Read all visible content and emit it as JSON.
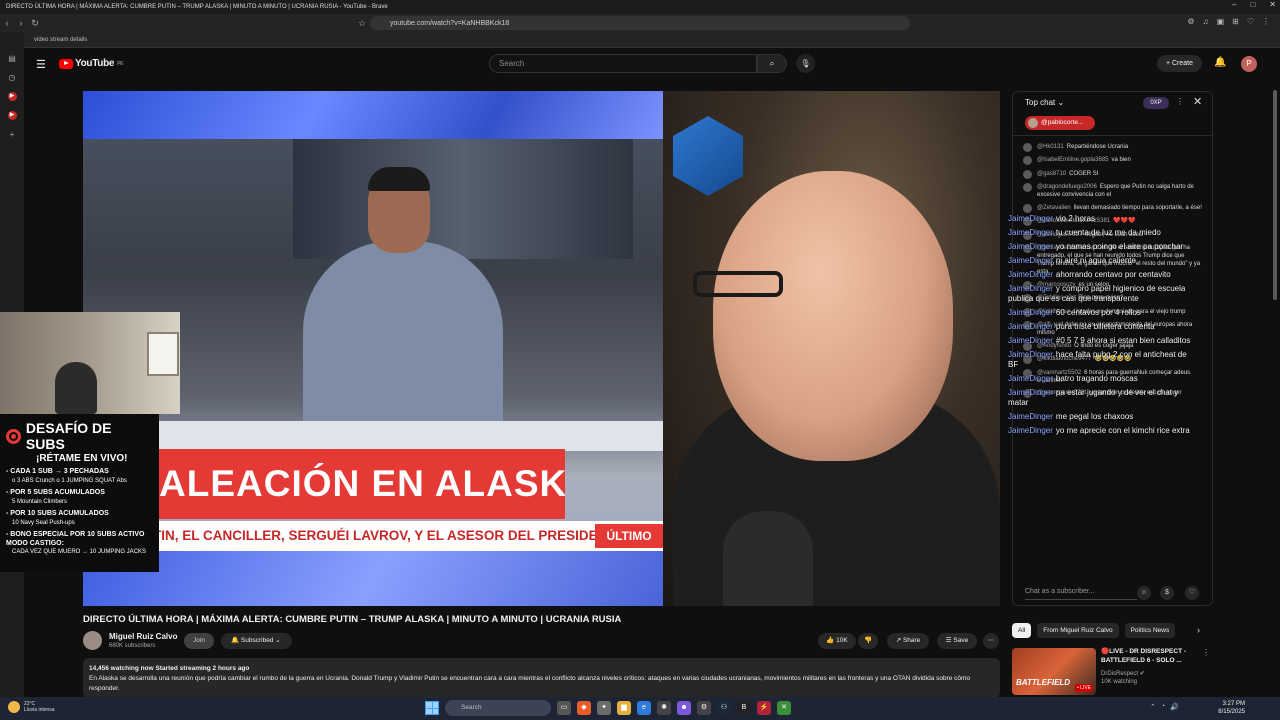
{
  "window": {
    "title": "DIRECTO ÚLTIMA HORA | MÁXIMA ALERTA: CUMBRE PUTIN – TRUMP ALASKA | MINUTO A MINUTO | UCRANIA RUSIA - YouTube - Brave",
    "controls": [
      "–",
      "□",
      "✕"
    ]
  },
  "browser": {
    "url": "youtube.com/watch?v=KaNHBBKck18",
    "bookmark": "video stream details",
    "ext_icons": [
      "⚙",
      "♫",
      "▣",
      "⊞",
      "♡",
      "⋮"
    ]
  },
  "youtube": {
    "logo_text": "YouTube",
    "logo_sup": "PE",
    "search_placeholder": "Search",
    "create_label": "+ Create",
    "avatar_letter": "P"
  },
  "video": {
    "lower_third": "ALEACIÓN EN ALASKA",
    "ticker": "TIN, EL CANCILLER, SERGUÉI LAVROV, Y EL ASESOR DEL PRESIDEN",
    "ticker_tag": "ÚLTIMO",
    "challenge": {
      "title": "DESAFÍO DE SUBS",
      "subtitle": "¡RÉTAME EN VIVO!",
      "items": [
        {
          "main": "- CADA 1 SUB → 3 PECHADAS",
          "small": "o 3 ABS Crunch o 1 JUMPING SQUAT Abs"
        },
        {
          "main": "- POR 5 SUBS ACUMULADOS",
          "small": "5 Mountain Climbers"
        },
        {
          "main": "- POR 10 SUBS ACUMULADOS",
          "small": "10 Navy Seal Push-ups"
        },
        {
          "main": "- BONO ESPECIAL POR 10 SUBS ACTIVO MODO CASTIGO:",
          "small": "CADA VEZ QUE MUERO → 10 JUMPING JACKS"
        }
      ]
    }
  },
  "meta": {
    "title": "DIRECTO ÚLTIMA HORA | MÁXIMA ALERTA: CUMBRE PUTIN – TRUMP ALASKA | MINUTO A MINUTO | UCRANIA RUSIA",
    "channel": "Miguel Ruiz Calvo",
    "subscribers": "680K subscribers",
    "join": "Join",
    "subscribed": "Subscribed",
    "likes": "10K",
    "share": "Share",
    "save": "Save",
    "stats": "14,456 watching now  Started streaming 2 hours ago",
    "description": "En Alaska se desarrolla una reunión que podría cambiar el rumbo de la guerra en Ucrania. Donald Trump y Vladimir Putin se encuentran cara a cara mientras el conflicto alcanza niveles críticos: ataques en varias ciudades ucranianas, movimientos militares en las fronteras y una OTAN dividida sobre cómo responder."
  },
  "chat": {
    "title": "Top chat",
    "xp": "0XP",
    "pinned_user": "@pablocorte...",
    "input_placeholder": "Chat as a subscriber...",
    "messages": [
      {
        "author": "@Hk0131",
        "text": "Repartiéndose Ucrania"
      },
      {
        "author": "@IsabelEmiline.gopla3685",
        "text": "va bien"
      },
      {
        "author": "@gas8710",
        "text": "COGER SI"
      },
      {
        "author": "@dragondefuego2006",
        "text": "Espero que Putin no salga harto de excesive convivencia con el"
      },
      {
        "author": "@Zetavalien",
        "text": "llevan demasiado tiempo para soportarle, a ése!"
      },
      {
        "author": "@carlosalbertoalvarez5381",
        "text": "❤️❤️❤️"
      },
      {
        "author": "@davidgian7337",
        "text": "Miguel, no sean asec!"
      },
      {
        "author": "@fernandezdahernanz",
        "text": "en de el territorio europeo que ha entregado, el que se han reunido todos Trump dice que Trump tendrá, se ganan que mucho \"el resto del mundo\" y ya esta."
      },
      {
        "author": "@marcoosuzy",
        "text": "es un seloo"
      },
      {
        "author": "@Tobillas-q2e",
        "text": "Bien para quien?"
      },
      {
        "author": "@lighthouse",
        "text": "Ustedes es demasiado para el viejo trump"
      },
      {
        "author": "@alfi",
        "text": "y el dolar no es el sepotomoneda del europas ahora mismo"
      },
      {
        "author": "@Andyfshito",
        "text": "O lindo es coger jajaja"
      },
      {
        "author": "@elkdiaknoche9477",
        "text": "🤣🤣🤣🤣🤣"
      },
      {
        "author": "@vanmartz5502",
        "text": "6 horas para guerraNuk começar adeus e...ahhhh"
      },
      {
        "author": "@arturogarza3731",
        "text": "yo también preferiría eso de coger"
      }
    ],
    "overlay": [
      {
        "name": "JaimeDinger",
        "text": "vio 2 horas"
      },
      {
        "name": "JaimeDinger",
        "text": "tu cuenta de luz me da miedo"
      },
      {
        "name": "JaimeDinger",
        "text": "yo namas poingo el aire pa ponchar"
      },
      {
        "name": "JaimeDinger",
        "text": "ni aire ni agua caliente"
      },
      {
        "name": "JaimeDinger",
        "text": "ahorrando centavo por centavito"
      },
      {
        "name": "JaimeDinger",
        "text": "y compro papel higienico de escuela publica que es casi que transparente"
      },
      {
        "name": "JaimeDinger",
        "text": "60 centavos por 4 rollos"
      },
      {
        "name": "JaimeDinger",
        "text": "pura triste billetera contenta"
      },
      {
        "name": "JaimeDinger",
        "text": "#0 5 7 9 ahora si estan bien calladitos"
      },
      {
        "name": "JaimeDinger",
        "text": "hace falta pubg 2 con el anticheat de BF"
      },
      {
        "name": "JaimeDinger",
        "text": "batro tragando moscas"
      },
      {
        "name": "JaimeDinger",
        "text": "pa estar jugando y de ver el chat y matar"
      },
      {
        "name": "JaimeDinger",
        "text": "me pegal los chaxoos"
      },
      {
        "name": "JaimeDinger",
        "text": "yo me aprecie con el kimchi rice extra"
      }
    ]
  },
  "sidebar": {
    "chips": [
      "All",
      "From Miguel Ruiz Calvo",
      "Politics News"
    ],
    "rec": {
      "title": "🔴LIVE - DR DISRESPECT - BATTLEFIELD 6 - SOLO ...",
      "channel": "DrDisRespect ✔",
      "views": "10K watching",
      "thumb_text": "BATTLEFIELD",
      "badge": "• LIVE"
    }
  },
  "taskbar": {
    "temp": "22°C",
    "weather": "Lluvia intensa",
    "search": "Search",
    "time": "3:27 PM",
    "date": "8/15/2025"
  },
  "colors": {
    "accent_red": "#ff0000",
    "news_red": "#e53935",
    "overlay_name": "#8fa6ff"
  }
}
